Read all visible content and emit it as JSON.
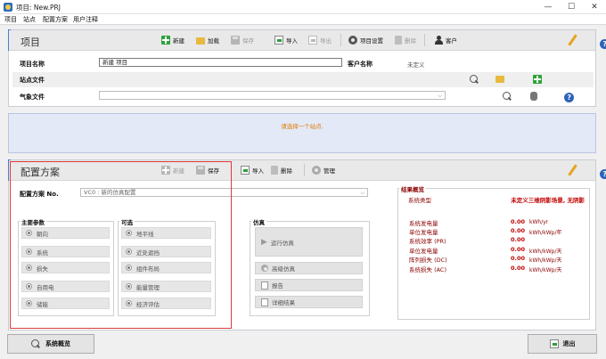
{
  "window": {
    "title": "项目: New.PRJ",
    "controls": [
      "—",
      "☐",
      "✕"
    ]
  },
  "menu": [
    "项目",
    "站点",
    "配置方案",
    "用户注释"
  ],
  "project_panel": {
    "title": "项目",
    "toolbar": {
      "new": "新建",
      "load": "加载",
      "save": "保存",
      "import": "导入",
      "export": "导出",
      "settings": "项目设置",
      "delete": "删除",
      "client": "客户"
    },
    "project_name_label": "项目名称",
    "project_name_value": "新建 项目",
    "client_name_label": "客户名称",
    "client_name_value": "未定义",
    "site_file_label": "站点文件",
    "weather_file_label": "气象文件"
  },
  "site_notice": "请选择一个站点.",
  "config_panel": {
    "title": "配置方案",
    "toolbar": {
      "new": "新建",
      "save": "保存",
      "import": "导入",
      "delete": "删除",
      "manage": "管理"
    },
    "variant_label": "配置方案 No.",
    "variant_value": "VC0     : 新的仿真配置",
    "main_params": {
      "title": "主要参数",
      "items": [
        "朝向",
        "系统",
        "损失",
        "自用电",
        "储能"
      ]
    },
    "optional": {
      "title": "可选",
      "items": [
        "地平线",
        "近处遮挡",
        "组件布局",
        "能量管理",
        "经济评估"
      ]
    },
    "simulation": {
      "title": "仿真",
      "run": "运行仿真",
      "advanced": "高级仿真",
      "report": "报告",
      "detailed": "详细结果"
    },
    "results": {
      "title": "结果概览",
      "system_type_label": "系统类型",
      "system_type_value": "未定义三维阴影场景, 无阴影",
      "rows": [
        {
          "label": "系统发电量",
          "value": "0.00",
          "unit": "kWh/yr"
        },
        {
          "label": "单位发电量",
          "value": "0.00",
          "unit": "kWh/kWp/年"
        },
        {
          "label": "系统效率 (PR)",
          "value": "0.00",
          "unit": ""
        },
        {
          "label": "单位发电量",
          "value": "0.00",
          "unit": "kWh/kWp/天"
        },
        {
          "label": "阵列损失 (DC)",
          "value": "0.00",
          "unit": "kWh/kWp/天"
        },
        {
          "label": "系统损失 (AC)",
          "value": "0.00",
          "unit": "kWh/kWp/天"
        }
      ]
    }
  },
  "bottom": {
    "overview": "系统概览",
    "exit": "退出"
  },
  "colors": {
    "accent": "#4a7fd0",
    "notice": "#e07b00",
    "highlight_frame": "#e0393a",
    "result_text": "#8b0000"
  }
}
